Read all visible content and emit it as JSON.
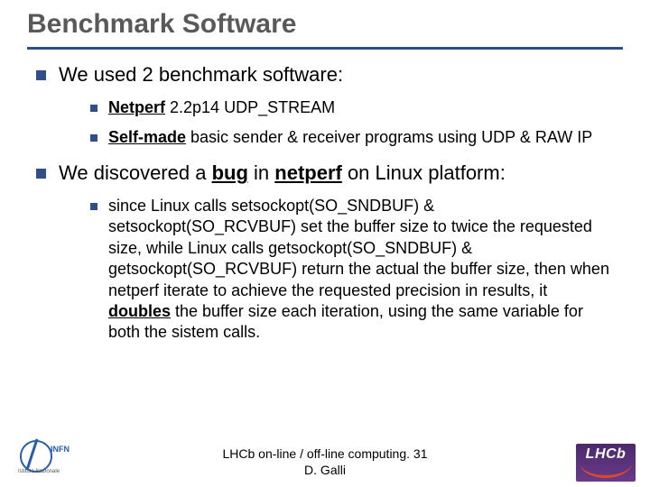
{
  "title": "Benchmark Software",
  "bullets": {
    "b1": "We used 2 benchmark software:",
    "b1_sub1_bold": "Netperf",
    "b1_sub1_rest": " 2.2p14 UDP_STREAM",
    "b1_sub2_bold": "Self-made",
    "b1_sub2_rest": " basic sender & receiver programs using UDP & RAW IP",
    "b2_pre": "We discovered a ",
    "b2_bug": "bug",
    "b2_mid": " in ",
    "b2_netperf": "netperf",
    "b2_post": " on Linux platform:",
    "b2_sub1_a": "since Linux calls setsockopt(SO_SNDBUF) & setsockopt(SO_RCVBUF) set the buffer size to twice the requested size, while Linux calls getsockopt(SO_SNDBUF) & getsockopt(SO_RCVBUF) return the actual the buffer size, then when netperf iterate to achieve the requested precision in results, it ",
    "b2_sub1_doubles": "doubles",
    "b2_sub1_b": " the buffer size each iteration, using the same variable for both the sistem calls."
  },
  "footer": {
    "line1": "LHCb on-line / off-line computing. 31",
    "line2": "D. Galli"
  },
  "logos": {
    "infn": "INFN",
    "infn_caption": "Istituto Nazionale",
    "lhcb": "LHCb"
  }
}
